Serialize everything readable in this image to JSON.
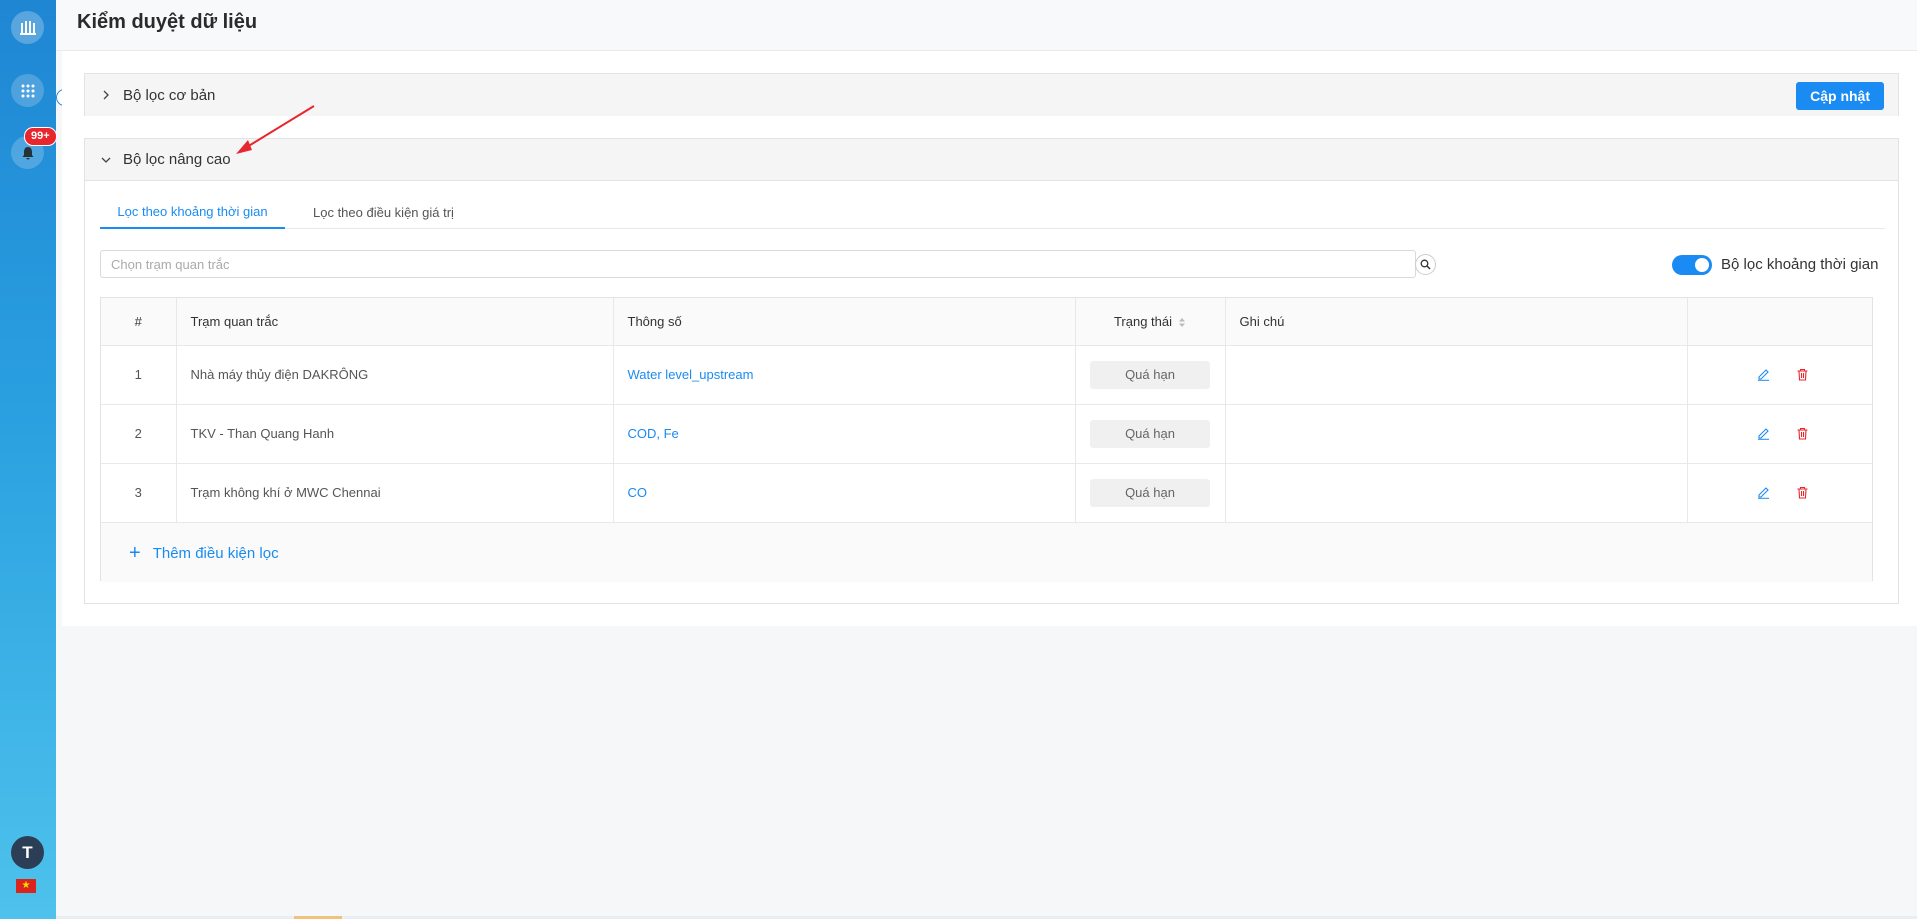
{
  "sidebar": {
    "notification_badge": "99+",
    "avatar_initial": "T",
    "icons": [
      "logo-icon",
      "apps-grid-icon",
      "bell-icon",
      "user-avatar",
      "vietnam-flag-icon"
    ]
  },
  "header": {
    "title": "Kiểm duyệt dữ liệu"
  },
  "basic_filter": {
    "title": "Bộ lọc cơ bản",
    "update_button": "Cập nhật"
  },
  "advanced_filter": {
    "title": "Bộ lọc nâng cao",
    "tabs": [
      {
        "label": "Lọc theo khoảng thời gian",
        "active": true
      },
      {
        "label": "Lọc theo điều kiện giá trị",
        "active": false
      }
    ],
    "search_placeholder": "Chọn trạm quan trắc",
    "toggle_label": "Bộ lọc khoảng thời gian",
    "toggle_on": true,
    "table": {
      "columns": [
        "#",
        "Trạm quan trắc",
        "Thông số",
        "Trạng thái",
        "Ghi chú",
        ""
      ],
      "rows": [
        {
          "num": "1",
          "station": "Nhà máy thủy điện DAKRÔNG",
          "param": "Water level_upstream",
          "status": "Quá hạn",
          "note": ""
        },
        {
          "num": "2",
          "station": "TKV - Than Quang Hanh",
          "param": "COD, Fe",
          "status": "Quá hạn",
          "note": ""
        },
        {
          "num": "3",
          "station": "Trạm không khí ở MWC Chennai",
          "param": "CO",
          "status": "Quá hạn",
          "note": ""
        }
      ]
    },
    "add_condition": "Thêm điều kiện lọc"
  },
  "colors": {
    "primary": "#1a8bf2",
    "danger": "#e8262d",
    "sidebar_top": "#1f86d4",
    "sidebar_bottom": "#4ec2ec"
  }
}
